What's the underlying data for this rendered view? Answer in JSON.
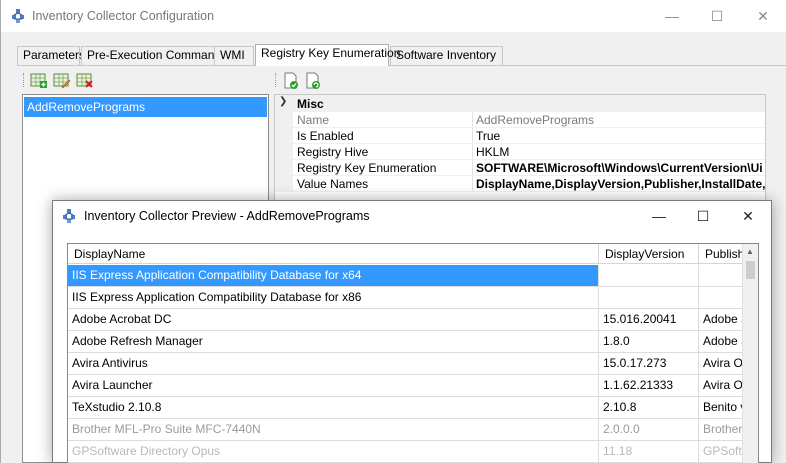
{
  "config_window": {
    "title": "Inventory Collector Configuration",
    "controls": {
      "minimize": "—",
      "maximize": "☐",
      "close": "✕"
    },
    "tabs": [
      {
        "label": "Parameters"
      },
      {
        "label": "Pre-Execution Commands"
      },
      {
        "label": "WMI"
      },
      {
        "label": "Registry Key Enumeration",
        "active": true
      },
      {
        "label": "Software Inventory"
      }
    ],
    "left_toolbar": [
      "add-icon",
      "edit-icon",
      "delete-icon"
    ],
    "right_toolbar": [
      "apply-icon",
      "refresh-icon"
    ],
    "list": {
      "items": [
        {
          "label": "AddRemovePrograms",
          "selected": true
        }
      ]
    },
    "property_grid": {
      "category": "Misc",
      "rows": [
        {
          "name": "Name",
          "value": "AddRemovePrograms",
          "readonly": true
        },
        {
          "name": "Is Enabled",
          "value": "True"
        },
        {
          "name": "Registry Hive",
          "value": "HKLM"
        },
        {
          "name": "Registry Key Enumeration",
          "value": "SOFTWARE\\Microsoft\\Windows\\CurrentVersion\\Ui",
          "bold": true
        },
        {
          "name": "Value Names",
          "value": "DisplayName,DisplayVersion,Publisher,InstallDate,I",
          "bold": true
        }
      ]
    }
  },
  "preview_window": {
    "title": "Inventory Collector Preview - AddRemovePrograms",
    "controls": {
      "minimize": "—",
      "maximize": "☐",
      "close": "✕"
    },
    "table": {
      "columns": [
        "DisplayName",
        "DisplayVersion",
        "Publishe"
      ],
      "rows": [
        {
          "name": "IIS Express Application Compatibility Database for x64",
          "version": "",
          "publisher": "",
          "selected": true
        },
        {
          "name": "IIS Express Application Compatibility Database for x86",
          "version": "",
          "publisher": ""
        },
        {
          "name": "Adobe Acrobat DC",
          "version": "15.016.20041",
          "publisher": "Adobe S"
        },
        {
          "name": "Adobe Refresh Manager",
          "version": "1.8.0",
          "publisher": "Adobe S"
        },
        {
          "name": "Avira Antivirus",
          "version": "15.0.17.273",
          "publisher": "Avira Op"
        },
        {
          "name": "Avira Launcher",
          "version": "1.1.62.21333",
          "publisher": "Avira Op"
        },
        {
          "name": "TeXstudio 2.10.8",
          "version": "2.10.8",
          "publisher": "Benito v"
        },
        {
          "name": "Brother MFL-Pro Suite MFC-7440N",
          "version": "2.0.0.0",
          "publisher": "Brother I",
          "faded": true
        },
        {
          "name": "GPSoftware Directory Opus",
          "version": "11.18",
          "publisher": "GPSoftw",
          "faded2": true
        }
      ]
    }
  }
}
